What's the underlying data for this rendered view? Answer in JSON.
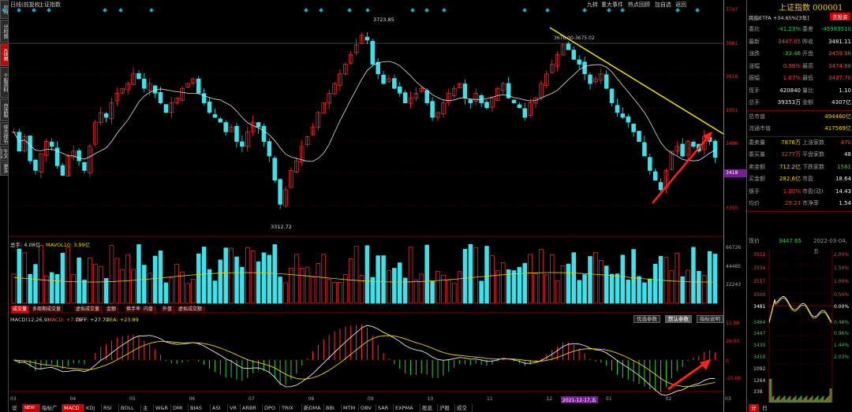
{
  "chart_title": "日线(前复权)",
  "index_name_label": "上证指数",
  "top_menu": [
    "九转",
    "重大事件",
    "热点回顾",
    "加自选",
    "返回"
  ],
  "left_tabs": [
    "应用",
    "分时图",
    "K线图",
    "个股资料",
    "自选股",
    "综合排名",
    "牛叉诊股",
    "更多"
  ],
  "left_tab_active": 2,
  "price_axis": {
    "ticks": [
      "3747",
      "3681",
      "3616",
      "3551",
      "3486",
      "3418",
      "3355"
    ],
    "current": "3418"
  },
  "vol_axis": {
    "ticks": [
      "66726",
      "44485",
      "22243"
    ]
  },
  "macd_axis": {
    "ticks": [
      "51.88",
      "26.03",
      "0",
      "-25.06"
    ]
  },
  "annotations": {
    "high": "3723.85",
    "low": "3312.72",
    "ref": "3676.00-3675.02",
    "date_label": "2021-12-17,五"
  },
  "volume_header": {
    "main": "总手: 4.08亿",
    "ma": "MAVOL10: 3.99亿"
  },
  "volume_tabs": [
    "成交量",
    "多周期成交量",
    "虚拟成交量",
    "金额",
    "换手率",
    "内盘",
    "外盘",
    "虚拟成交额"
  ],
  "macd_header": {
    "params": "MACD(12,26,9)",
    "macd": "MACD: +7.75",
    "diff": "DIFF: +27.77",
    "dea": "DEA: +23.89"
  },
  "macd_buttons": [
    "优选参数",
    "默认参数",
    "指标说明"
  ],
  "x_months": [
    "03",
    "04",
    "05",
    "06",
    "07",
    "08",
    "09",
    "10",
    "11",
    "12",
    "01",
    "02",
    "03"
  ],
  "bottom_tabs": [
    "设置",
    "NEW",
    "指标广场",
    "MACD",
    "KDJ",
    "RSI",
    "BOLL",
    "主力",
    "W&R",
    "DMI",
    "BIAS",
    "ASI",
    "VR",
    "ARBR",
    "DPO",
    "TRIX",
    "新DMA",
    "BBI",
    "MTM",
    "OBV",
    "SAR",
    "EXPMA",
    "股息值",
    "沪股通",
    "成交率"
  ],
  "bottom_active": "MACD",
  "right_panel": {
    "title": "上证指数 000001",
    "etf": "跨指ETFA +34.65%[3年]",
    "etf_btn": "去投资",
    "rows": [
      [
        "委比",
        "-41.23%",
        "委差",
        "-45983510"
      ],
      [
        "最新",
        "3447.65",
        "昨收",
        "3481.11"
      ],
      [
        "涨跌",
        "-33.46",
        "开盘",
        "3459.98"
      ],
      [
        "涨幅",
        "0.96%",
        "最高",
        "3474.88"
      ],
      [
        "振幅",
        "1.07%",
        "最低",
        "3437.70"
      ],
      [
        "现手",
        "420840",
        "量比",
        "1.10"
      ],
      [
        "总手",
        "39353万",
        "金额",
        "4307亿"
      ]
    ],
    "rows2": [
      [
        "总市值",
        "494460亿"
      ],
      [
        "流通市值",
        "417569亿"
      ]
    ],
    "rows3": [
      [
        "委卖量",
        "7876万",
        "上涨家数",
        "470"
      ],
      [
        "委买量",
        "3277万",
        "平盘家数",
        "48"
      ],
      [
        "卖金额",
        "712.2亿",
        "下跌家数",
        "1581"
      ],
      [
        "买金额",
        "282.6亿",
        "市盈",
        "18.64"
      ],
      [
        "换手",
        "1.00%",
        "市盈(动)",
        "14.43"
      ],
      [
        "均价",
        "29.23",
        "市净率",
        "1.54"
      ]
    ],
    "mini": {
      "label": "现价",
      "price": "3447.65",
      "date": "2022-03-04,五"
    },
    "mini_left": [
      "3551",
      "3534",
      "3517",
      "3500",
      "3481",
      "3464",
      "3447",
      "3430",
      "3410",
      "1092",
      "1264",
      "938",
      "338"
    ],
    "mini_right": [
      "2.00%",
      "1.50%",
      "1.00%",
      "0.50%",
      "0.00%",
      "0.48%",
      "0.96%",
      "1.44%",
      "2.03%"
    ],
    "mini_tabs": [
      "分",
      "日"
    ]
  },
  "chart_data": {
    "type": "candlestick",
    "ylim": [
      3300,
      3760
    ],
    "closes": [
      3500,
      3460,
      3490,
      3440,
      3420,
      3455,
      3480,
      3470,
      3430,
      3410,
      3450,
      3460,
      3440,
      3420,
      3470,
      3520,
      3540,
      3530,
      3560,
      3580,
      3590,
      3600,
      3620,
      3610,
      3590,
      3600,
      3580,
      3560,
      3540,
      3560,
      3570,
      3590,
      3600,
      3610,
      3580,
      3560,
      3540,
      3530,
      3520,
      3500,
      3510,
      3480,
      3470,
      3500,
      3520,
      3510,
      3480,
      3450,
      3400,
      3350,
      3380,
      3420,
      3440,
      3470,
      3490,
      3510,
      3540,
      3560,
      3580,
      3600,
      3620,
      3640,
      3660,
      3680,
      3700,
      3690,
      3640,
      3620,
      3600,
      3610,
      3590,
      3580,
      3560,
      3570,
      3580,
      3590,
      3560,
      3530,
      3540,
      3560,
      3580,
      3590,
      3600,
      3570,
      3560,
      3580,
      3560,
      3550,
      3570,
      3590,
      3600,
      3570,
      3560,
      3550,
      3530,
      3560,
      3570,
      3600,
      3620,
      3640,
      3660,
      3680,
      3670,
      3650,
      3640,
      3620,
      3600,
      3610,
      3620,
      3590,
      3560,
      3540,
      3530,
      3520,
      3500,
      3480,
      3450,
      3420,
      3400,
      3380,
      3420,
      3460,
      3470,
      3450,
      3480,
      3470,
      3460,
      3490,
      3480,
      3447
    ]
  }
}
